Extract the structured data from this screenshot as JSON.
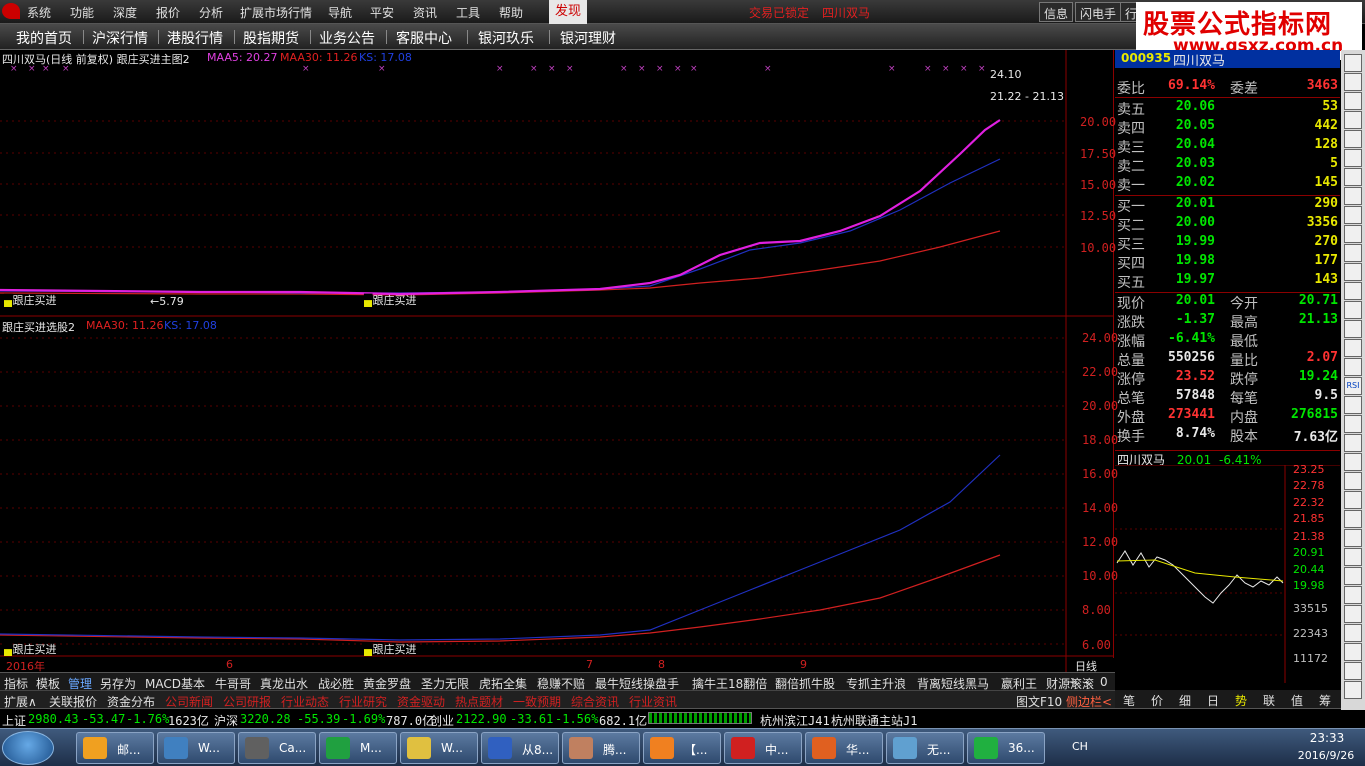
{
  "menubar": {
    "items": [
      "系统",
      "功能",
      "深度",
      "报价",
      "分析",
      "扩展市场行情",
      "导航",
      "平安",
      "资讯",
      "工具",
      "帮助"
    ],
    "faxian": "发现",
    "alert_locked": "交易已锁定",
    "alert_stock": "四川双马",
    "buttons": [
      "信息",
      "闪电手",
      "行"
    ]
  },
  "watermark": {
    "title": "股票公式指标网",
    "url": "www.gsxz.com.cn"
  },
  "navbar": {
    "items": [
      "我的首页",
      "沪深行情",
      "港股行情",
      "股指期货",
      "业务公告",
      "客服中心",
      "银河玖乐",
      "银河理财"
    ]
  },
  "main_chart": {
    "header_name": "四川双马(日线 前复权) 跟庄买进主图2",
    "ma5": "MAA5: 20.27",
    "ma30": "MAA30: 11.26",
    "ks": "KS: 17.08",
    "price_high_label": "24.10",
    "price_range_label": "21.22 - 21.13",
    "low_label": "←5.79",
    "signal_label": "跟庄买进",
    "axis_labels": [
      "20.00",
      "17.50",
      "15.00",
      "12.50",
      "10.00"
    ]
  },
  "sub_chart": {
    "header_name": "跟庄买进选股2",
    "ma30": "MAA30: 11.26",
    "ks": "KS: 17.08",
    "axis_labels": [
      "24.00",
      "22.00",
      "20.00",
      "18.00",
      "16.00",
      "14.00",
      "12.00",
      "10.00",
      "8.00",
      "6.00"
    ],
    "signal_label": "跟庄买进"
  },
  "date_axis": {
    "year": "2016年",
    "months": [
      "6",
      "7",
      "8",
      "9"
    ],
    "period": "日线"
  },
  "quote": {
    "code": "000935",
    "name": "四川双马",
    "weibi_label": "委比",
    "weibi": "69.14%",
    "weicha_label": "委差",
    "weicha": "3463",
    "sells": [
      {
        "label": "卖五",
        "price": "20.06",
        "vol": "53"
      },
      {
        "label": "卖四",
        "price": "20.05",
        "vol": "442"
      },
      {
        "label": "卖三",
        "price": "20.04",
        "vol": "128"
      },
      {
        "label": "卖二",
        "price": "20.03",
        "vol": "5"
      },
      {
        "label": "卖一",
        "price": "20.02",
        "vol": "145"
      }
    ],
    "buys": [
      {
        "label": "买一",
        "price": "20.01",
        "vol": "290"
      },
      {
        "label": "买二",
        "price": "20.00",
        "vol": "3356"
      },
      {
        "label": "买三",
        "price": "19.99",
        "vol": "270"
      },
      {
        "label": "买四",
        "price": "19.98",
        "vol": "177"
      },
      {
        "label": "买五",
        "price": "19.97",
        "vol": "143"
      }
    ],
    "stats": [
      {
        "l1": "现价",
        "v1": "20.01",
        "c1": "dn",
        "l2": "今开",
        "v2": "20.71",
        "c2": "dn"
      },
      {
        "l1": "涨跌",
        "v1": "-1.37",
        "c1": "dn",
        "l2": "最高",
        "v2": "21.13",
        "c2": "dn"
      },
      {
        "l1": "涨幅",
        "v1": "-6.41%",
        "c1": "dn",
        "l2": "最低",
        "v2": "",
        "c2": "dn"
      },
      {
        "l1": "总量",
        "v1": "550256",
        "c1": "wh",
        "l2": "量比",
        "v2": "2.07",
        "c2": "up"
      },
      {
        "l1": "涨停",
        "v1": "23.52",
        "c1": "up",
        "l2": "跌停",
        "v2": "19.24",
        "c2": "dn"
      },
      {
        "l1": "总笔",
        "v1": "57848",
        "c1": "wh",
        "l2": "每笔",
        "v2": "9.5",
        "c2": "wh"
      },
      {
        "l1": "外盘",
        "v1": "273441",
        "c1": "up",
        "l2": "内盘",
        "v2": "276815",
        "c2": "dn"
      },
      {
        "l1": "换手",
        "v1": "8.74%",
        "c1": "wh",
        "l2": "股本",
        "v2": "7.63亿",
        "c2": "wh"
      }
    ],
    "mini_title": "四川双马",
    "mini_price": "20.01",
    "mini_pct": "-6.41%",
    "mini_axis": [
      "23.25",
      "22.78",
      "22.32",
      "21.85",
      "21.38",
      "20.91",
      "20.44",
      "19.98",
      "33515",
      "22343",
      "11172"
    ]
  },
  "tabs1": [
    "指标",
    "模板",
    "管理",
    "另存为",
    "MACD基本",
    "牛哥哥",
    "真龙出水",
    "战必胜",
    "黄金罗盘",
    "圣力无限",
    "虎拓全集",
    "稳赚不赔",
    "最牛短线操盘手",
    "擒牛王18翻倍",
    "翻倍抓牛股",
    "专抓主升浪",
    "背离短线黑马",
    "嬴利王",
    "财源滚滚"
  ],
  "tabs1_ctrl": [
    "+",
    "-",
    "0"
  ],
  "tabs2": [
    "扩展∧",
    "关联报价",
    "资金分布",
    "公司新闻",
    "公司研报",
    "行业动态",
    "行业研究",
    "资金驱动",
    "热点题材",
    "一致预期",
    "综合资讯",
    "行业资讯"
  ],
  "tabs2_right": [
    "图文F10",
    "侧边栏<"
  ],
  "bottom_right": [
    "笔",
    "价",
    "细",
    "日",
    "势",
    "联",
    "值",
    "筹"
  ],
  "status": {
    "sh_label": "上证",
    "sh_val": "2980.43",
    "sh_chg": "-53.47",
    "sh_pct": "-1.76%",
    "sh_amt": "1623亿",
    "hs_label": "沪深",
    "hs_val": "3220.28",
    "hs_chg": "-55.39",
    "hs_pct": "-1.69%",
    "hs_amt": "787.0亿",
    "cy_label": "创业",
    "cy_val": "2122.90",
    "cy_chg": "-33.61",
    "cy_pct": "-1.56%",
    "cy_amt": "682.1亿",
    "server1": "杭州滨江J41",
    "server2": "杭州联通主站J1"
  },
  "taskbar": {
    "tasks": [
      "邮...",
      "W...",
      "Ca...",
      "M...",
      "W...",
      "从8...",
      "腾...",
      "【...",
      "中...",
      "华...",
      "无...",
      "36..."
    ],
    "clock": "23:33",
    "date": "2016/9/26",
    "ime": "CH"
  },
  "side_toolbar": [
    "RSI"
  ]
}
